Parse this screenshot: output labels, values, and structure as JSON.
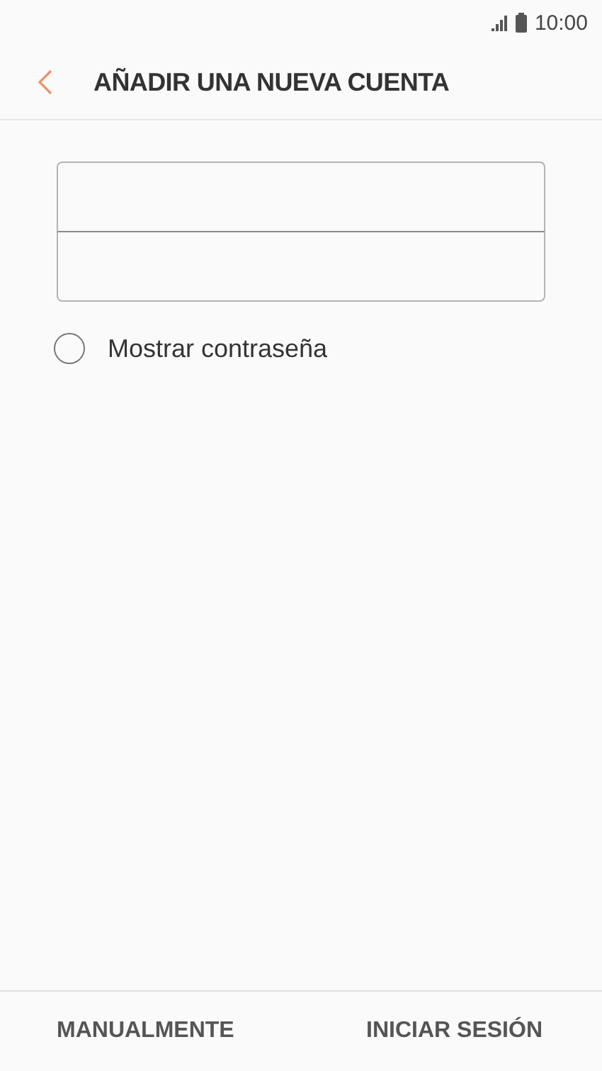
{
  "status_bar": {
    "time": "10:00"
  },
  "header": {
    "title": "AÑADIR UNA NUEVA CUENTA"
  },
  "show_password": {
    "label": "Mostrar contraseña",
    "checked": false
  },
  "buttons": [
    "MANUALMENTE",
    "INICIAR SESIÓN"
  ]
}
